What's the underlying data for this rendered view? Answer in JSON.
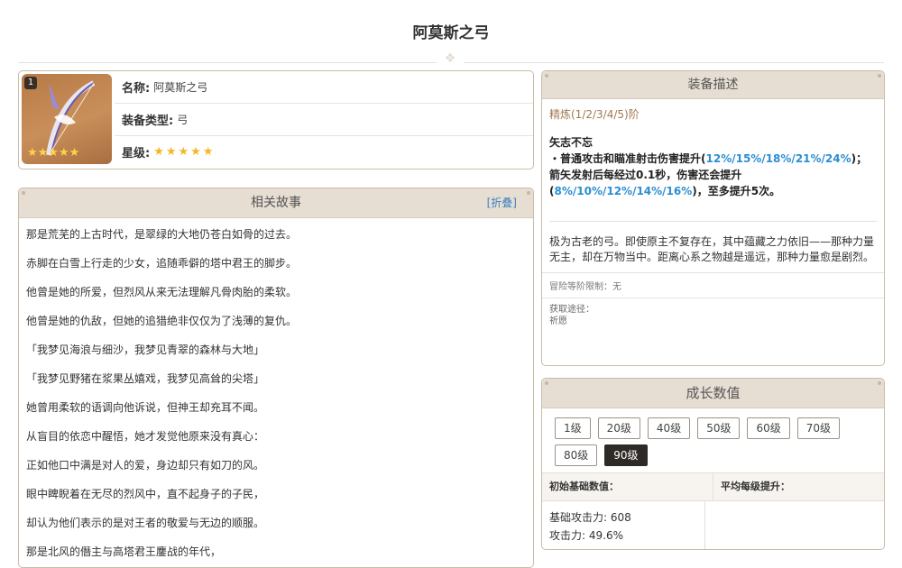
{
  "page": {
    "title": "阿莫斯之弓"
  },
  "info": {
    "rarity_badge": "1",
    "name_label": "名称:",
    "name_value": "阿莫斯之弓",
    "type_label": "装备类型:",
    "type_value": "弓",
    "star_label": "星级:",
    "star_value": "★★★★★",
    "thumb_stars": "★★★★★"
  },
  "story": {
    "header": "相关故事",
    "fold_label": "[折叠]",
    "lines": [
      "那是荒芜的上古时代，是翠绿的大地仍苍白如骨的过去。",
      "赤脚在白雪上行走的少女，追随乖僻的塔中君王的脚步。",
      "他曾是她的所爱，但烈风从来无法理解凡骨肉胎的柔软。",
      "他曾是她的仇敌，但她的追猎绝非仅仅为了浅薄的复仇。",
      "「我梦见海浪与细沙，我梦见青翠的森林与大地」",
      "「我梦见野猪在浆果丛嬉戏，我梦见高耸的尖塔」",
      "她曾用柔软的语调向他诉说，但神王却充耳不闻。",
      "从盲目的依恋中醒悟，她才发觉他原来没有真心：",
      "正如他口中满是对人的爱，身边却只有如刀的风。",
      "眼中睥睨着在无尽的烈风中，直不起身子的子民，",
      "却认为他们表示的是对王者的敬爱与无边的顺服。",
      "那是北风的僭主与高塔君王鏖战的年代，"
    ]
  },
  "desc": {
    "header": "装备描述",
    "refine": "精炼(1/2/3/4/5)阶",
    "skill_name": "矢志不忘",
    "skill_p1": "・普通攻击和瞄准射击伤害提升(",
    "skill_h1": "12%/15%/18%/21%/24%",
    "skill_p2": ")；箭矢发射后每经过0.1秒，伤害还会提升(",
    "skill_h2": "8%/10%/12%/14%/16%",
    "skill_p3": ")，至多提升5次。",
    "lore": "极为古老的弓。即使原主不复存在，其中蕴藏之力依旧——那种力量无主，却在万物当中。距离心系之物越是遥远，那种力量愈是剧烈。",
    "ascension_limit": "冒险等阶限制：无",
    "source_label": "获取途径：",
    "source_value": "祈愿"
  },
  "growth": {
    "header": "成长数值",
    "levels": [
      "1级",
      "20级",
      "40级",
      "50级",
      "60级",
      "70级",
      "80级",
      "90级"
    ],
    "active_level": "90级",
    "col_base": "初始基础数值：",
    "col_avg": "平均每级提升：",
    "stat_atk": "基础攻击力: 608",
    "stat_atk_pct": "攻击力: 49.6%"
  }
}
